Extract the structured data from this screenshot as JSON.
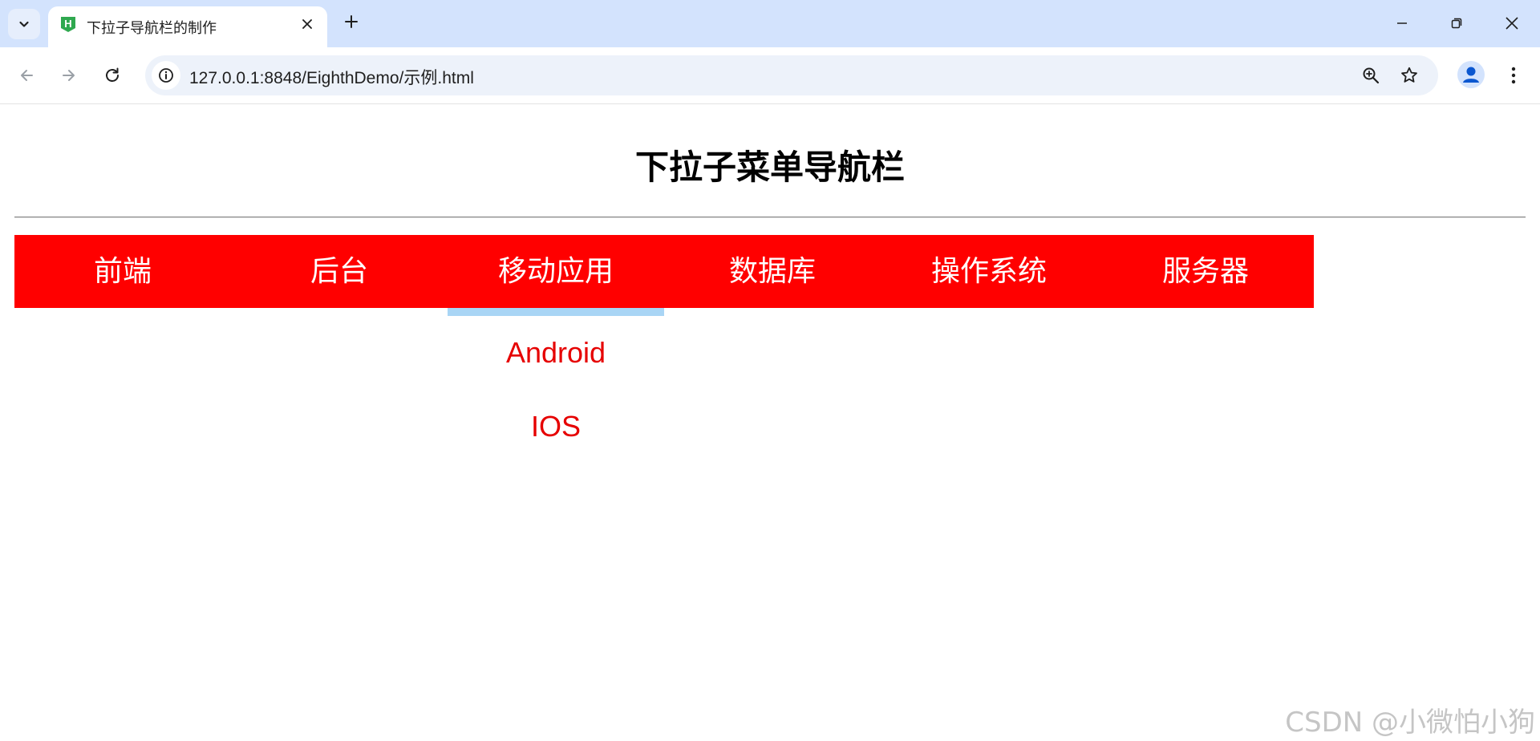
{
  "browser": {
    "tab_title": "下拉子导航栏的制作",
    "url": "127.0.0.1:8848/EighthDemo/示例.html",
    "favicon_letter": "H"
  },
  "page": {
    "title": "下拉子菜单导航栏",
    "nav_items": [
      "前端",
      "后台",
      "移动应用",
      "数据库",
      "操作系统",
      "服务器"
    ],
    "active_nav": "移动应用",
    "submenu": [
      "Android",
      "IOS"
    ]
  },
  "watermark": "CSDN @小微怕小狗",
  "colors": {
    "navbar": "#ff0000",
    "nav_text": "#ffffff",
    "submenu_text": "#e60000",
    "active_indicator": "#a9d5f5",
    "tabstrip": "#d3e3fd"
  }
}
